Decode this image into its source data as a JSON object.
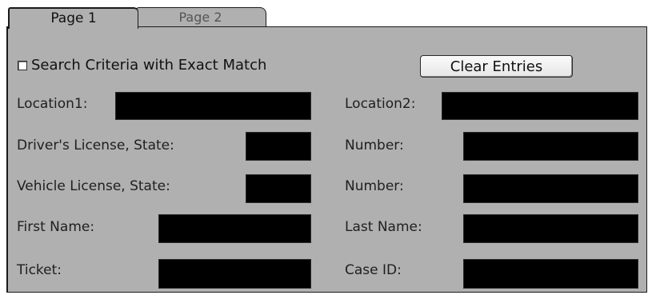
{
  "tabs": [
    {
      "label": "Page 1",
      "active": true
    },
    {
      "label": "Page 2",
      "active": false
    }
  ],
  "exact_match": {
    "label": "Search Criteria with Exact Match",
    "checked": false
  },
  "clear_button": {
    "label": "Clear Entries"
  },
  "fields": {
    "location1": {
      "label": "Location1:",
      "value": ""
    },
    "location2": {
      "label": "Location2:",
      "value": ""
    },
    "drivers_license_state": {
      "label": "Driver's License, State:",
      "value": ""
    },
    "drivers_license_number": {
      "label": "Number:",
      "value": ""
    },
    "vehicle_license_state": {
      "label": "Vehicle License, State:",
      "value": ""
    },
    "vehicle_license_number": {
      "label": "Number:",
      "value": ""
    },
    "first_name": {
      "label": "First Name:",
      "value": ""
    },
    "last_name": {
      "label": "Last Name:",
      "value": ""
    },
    "ticket": {
      "label": "Ticket:",
      "value": ""
    },
    "case_id": {
      "label": "Case ID:",
      "value": ""
    }
  },
  "colors": {
    "panel_bg": "#b0b0b0",
    "field_bg": "#000000",
    "border": "#1a1a1a"
  }
}
